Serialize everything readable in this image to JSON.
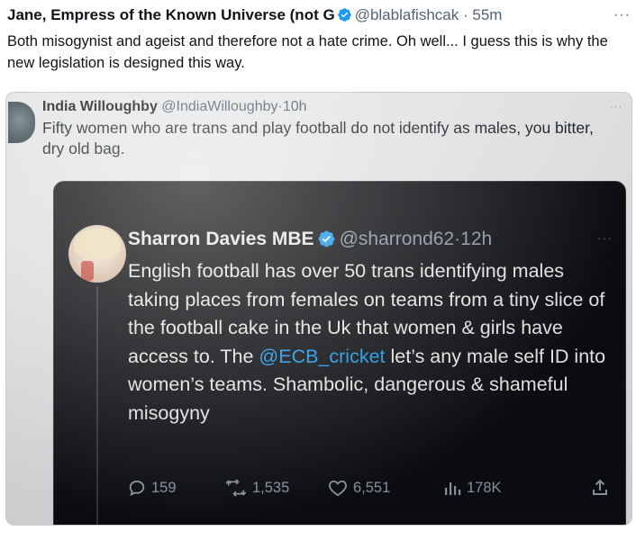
{
  "outer_tweet": {
    "name": "Jane, Empress of the Known Universe (not G",
    "handle": "@blablafishcak",
    "separator": "·",
    "time": "55m",
    "more": "···",
    "text": "Both misogynist and ageist and therefore not a hate crime. Oh well... I guess this is why the new legislation is designed this way."
  },
  "photo": {
    "quoted_tweet": {
      "name": "India Willoughby",
      "handle": "@IndiaWilloughby",
      "separator": "·",
      "time": "10h",
      "more": "···",
      "text": "Fifty women who are trans and play football do not identify as males, you bitter, dry old bag."
    },
    "embedded_tweet": {
      "name": "Sharron Davies MBE",
      "handle": "@sharrond62",
      "separator": "·",
      "time": "12h",
      "more": "···",
      "text_before": "English football has over 50 trans identifying males taking places from females  on teams from a tiny slice of the football cake in the Uk that women & girls have access to. The ",
      "mention": "@ECB_cricket",
      "text_after": " let’s any male self ID into women’s teams. Shambolic, dangerous & shameful misogyny",
      "replies": "159",
      "retweets": "1,535",
      "likes": "6,551",
      "views": "178K"
    }
  },
  "colors": {
    "verified_blue": "#1d9bf0",
    "dark_bg": "#0b0d10",
    "muted": "#536471"
  },
  "icons": [
    "verified-icon",
    "more-icon",
    "reply-icon",
    "retweet-icon",
    "like-icon",
    "views-icon",
    "share-icon"
  ]
}
